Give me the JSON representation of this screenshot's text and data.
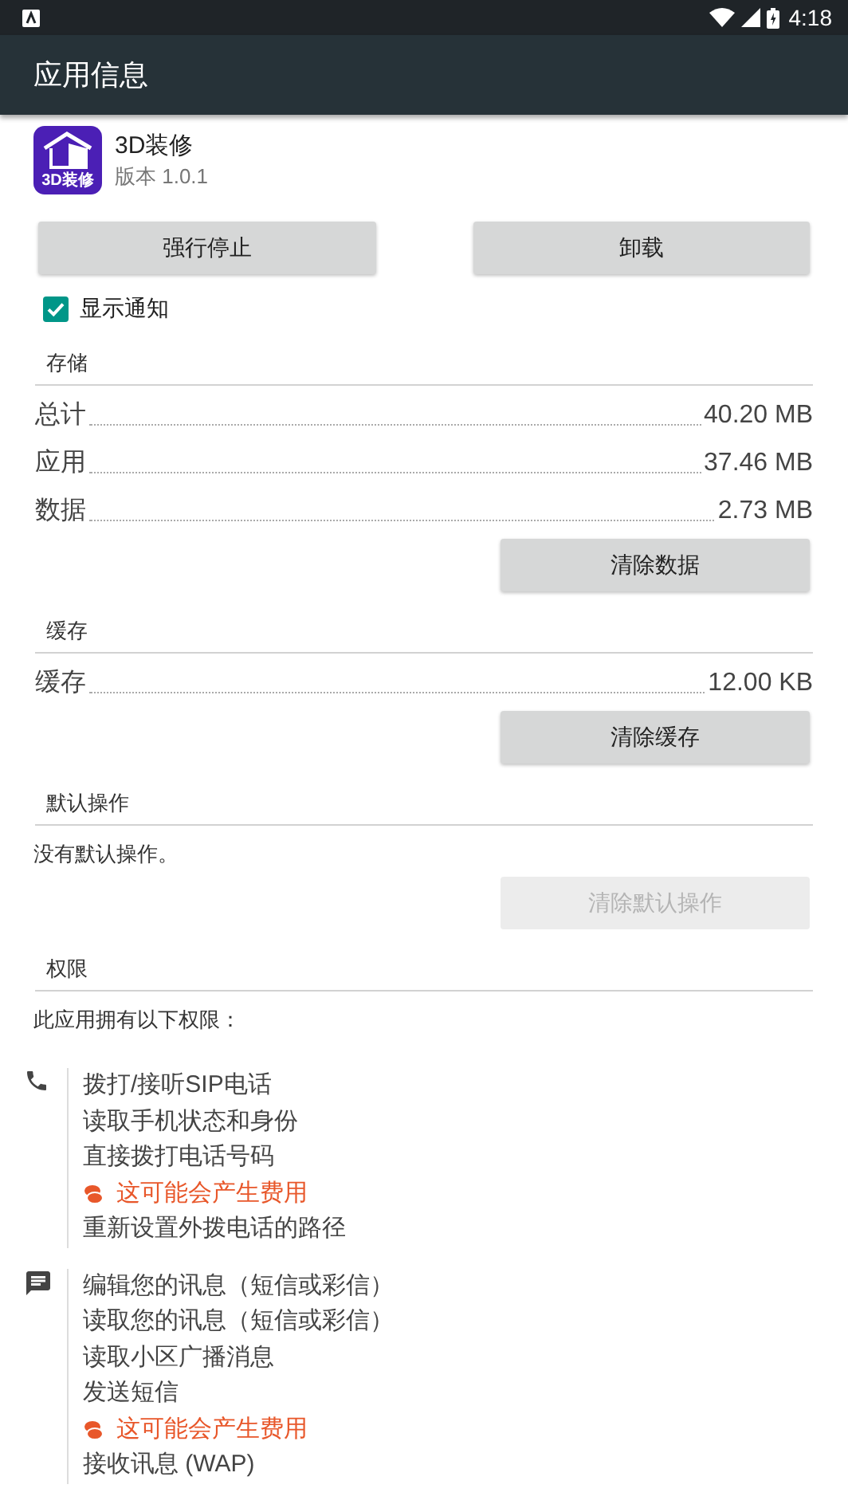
{
  "status_bar": {
    "time": "4:18"
  },
  "app_bar": {
    "title": "应用信息"
  },
  "app": {
    "name": "3D装修",
    "version": "版本 1.0.1",
    "icon_text": "3D装修"
  },
  "actions": [
    {
      "label": "强行停止",
      "disabled": false
    },
    {
      "label": "卸载",
      "disabled": false
    }
  ],
  "notifications": {
    "label": "显示通知",
    "checked": true
  },
  "sections": [
    {
      "title": "存储",
      "rows": [
        {
          "label": "总计",
          "value": "40.20 MB"
        },
        {
          "label": "应用",
          "value": "37.46 MB"
        },
        {
          "label": "数据",
          "value": "2.73 MB"
        }
      ],
      "button": {
        "label": "清除数据",
        "disabled": false
      }
    },
    {
      "title": "缓存",
      "rows": [
        {
          "label": "缓存",
          "value": "12.00 KB"
        }
      ],
      "button": {
        "label": "清除缓存",
        "disabled": false
      }
    },
    {
      "title": "默认操作",
      "text": "没有默认操作。",
      "button": {
        "label": "清除默认操作",
        "disabled": true
      }
    }
  ],
  "permissions": {
    "title": "权限",
    "intro": "此应用拥有以下权限：",
    "groups": [
      {
        "kind": "phone",
        "items": [
          {
            "kind": "normal",
            "text": "拨打/接听SIP电话"
          },
          {
            "kind": "normal",
            "text": "读取手机状态和身份"
          },
          {
            "kind": "normal",
            "text": "直接拨打电话号码"
          },
          {
            "kind": "cost",
            "text": "这可能会产生费用"
          },
          {
            "kind": "normal",
            "text": "重新设置外拨电话的路径"
          }
        ]
      },
      {
        "kind": "sms",
        "items": [
          {
            "kind": "normal",
            "text": "编辑您的讯息（短信或彩信）"
          },
          {
            "kind": "normal",
            "text": "读取您的讯息（短信或彩信）"
          },
          {
            "kind": "normal",
            "text": "读取小区广播消息"
          },
          {
            "kind": "normal",
            "text": "发送短信"
          },
          {
            "kind": "cost",
            "text": "这可能会产生费用"
          },
          {
            "kind": "normal",
            "text": "接收讯息 (WAP)"
          }
        ]
      }
    ]
  }
}
